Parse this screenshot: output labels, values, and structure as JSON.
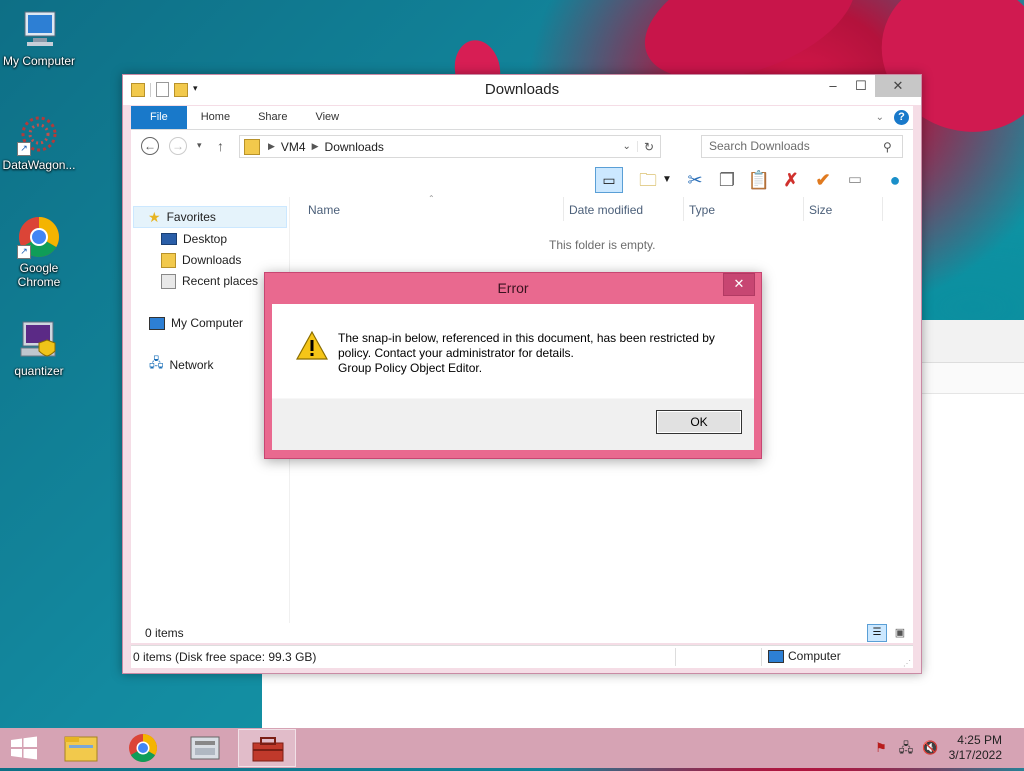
{
  "desktop": {
    "icons": [
      {
        "label": "My Computer"
      },
      {
        "label": "DataWagon..."
      },
      {
        "label": "Google Chrome"
      },
      {
        "label": "quantizer"
      }
    ]
  },
  "explorer": {
    "title": "Downloads",
    "ribbon_tabs": [
      "File",
      "Home",
      "Share",
      "View"
    ],
    "address": {
      "root": "VM4",
      "current": "Downloads"
    },
    "search_placeholder": "Search Downloads",
    "nav": {
      "favorites": "Favorites",
      "desktop": "Desktop",
      "downloads": "Downloads",
      "recent": "Recent places",
      "my_computer": "My Computer",
      "network": "Network"
    },
    "columns": [
      "Name",
      "Date modified",
      "Type",
      "Size"
    ],
    "empty_text": "This folder is empty.",
    "item_count": "0 items",
    "status_left": "0 items (Disk free space: 99.3 GB)",
    "status_right": "Computer"
  },
  "dialog": {
    "title": "Error",
    "message_line1": "The snap-in below, referenced in this document, has been restricted by",
    "message_line2": "policy. Contact your administrator for details.",
    "message_line3": "Group Policy Object Editor.",
    "ok_label": "OK"
  },
  "taskbar": {
    "time": "4:25 PM",
    "date": "3/17/2022"
  },
  "colors": {
    "accent": "#1979ca",
    "dialog_frame": "#e9698f",
    "taskbar": "#d6a3b4"
  }
}
